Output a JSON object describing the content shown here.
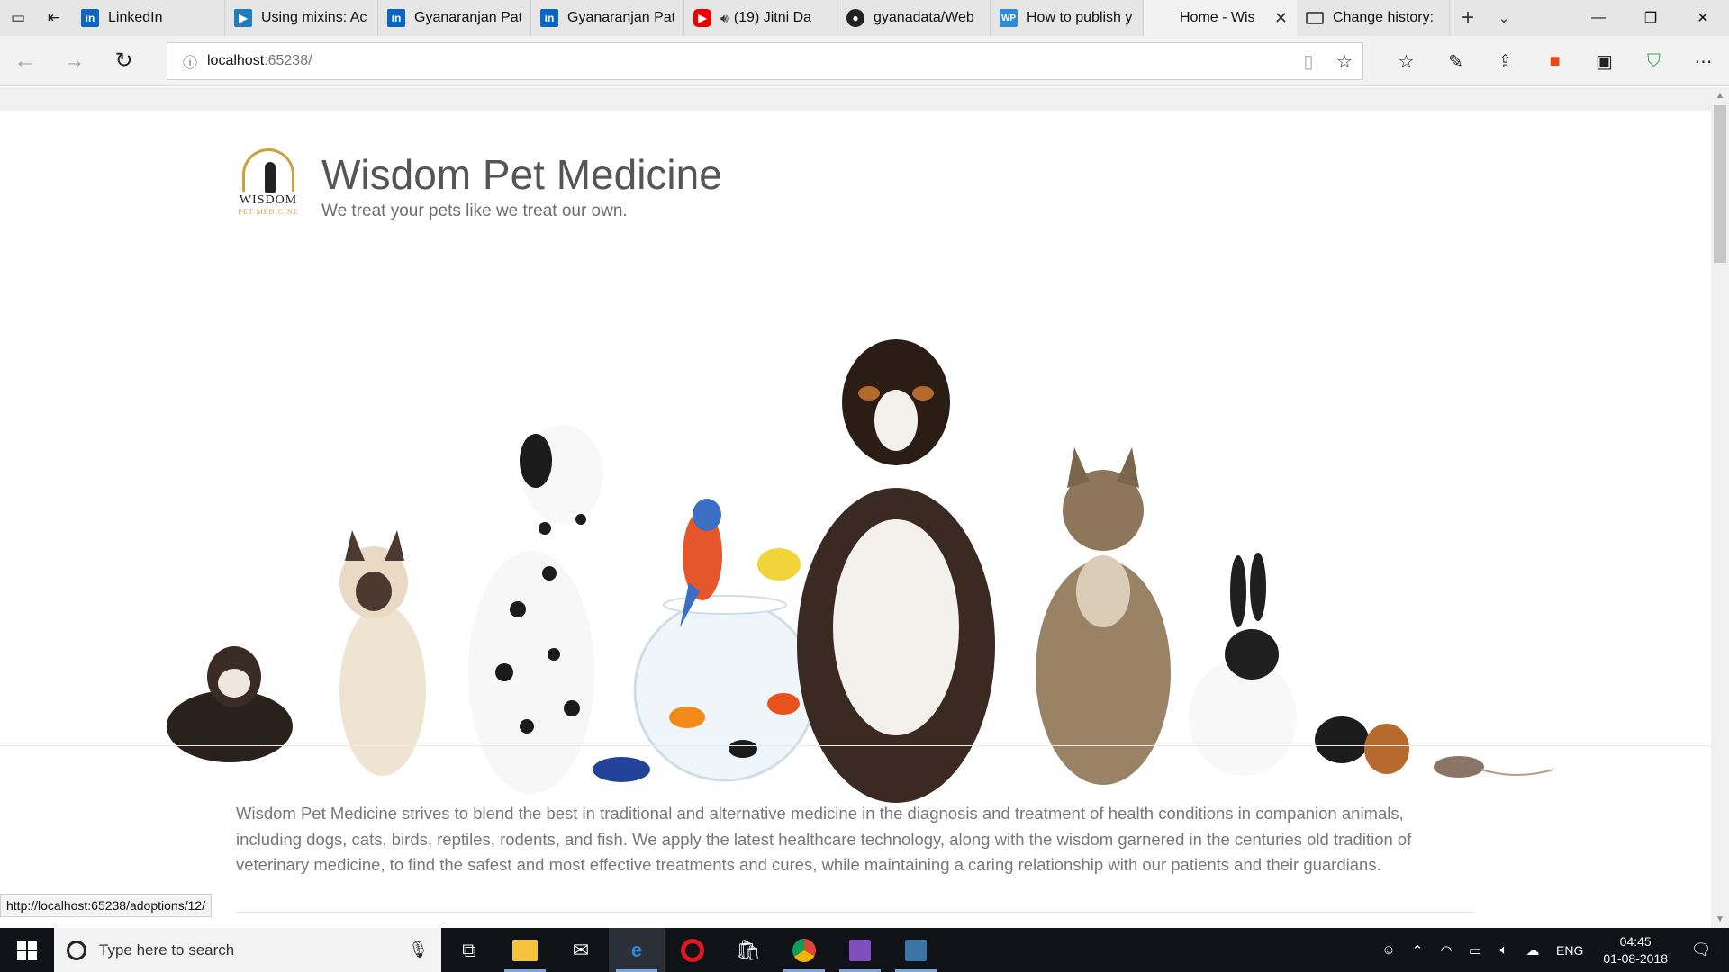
{
  "browser": {
    "tabs": [
      {
        "title": "LinkedIn",
        "favicon": "linkedin-icon"
      },
      {
        "title": "Using mixins: Ac",
        "favicon": "video-icon"
      },
      {
        "title": "Gyanaranjan Pat",
        "favicon": "linkedin-icon"
      },
      {
        "title": "Gyanaranjan Pat",
        "favicon": "linkedin-icon"
      },
      {
        "title": "(19) Jitni Da",
        "favicon": "youtube-icon",
        "playing_audio": true
      },
      {
        "title": "gyanadata/Web",
        "favicon": "github-icon"
      },
      {
        "title": "How to publish y",
        "favicon": "wordpress-icon"
      },
      {
        "title": "Home - Wis",
        "favicon": "",
        "active": true
      },
      {
        "title": "Change history:",
        "favicon": "page-icon"
      }
    ],
    "address": {
      "host": "localhost",
      "port": ":65238/"
    },
    "status_url": "http://localhost:65238/adoptions/12/"
  },
  "page": {
    "logo": {
      "line1": "WISDOM",
      "line2": "PET MEDICINE"
    },
    "title": "Wisdom Pet Medicine",
    "tagline": "We treat your pets like we treat our own.",
    "intro": "Wisdom Pet Medicine strives to blend the best in traditional and alternative medicine in the diagnosis and treatment of health conditions in companion animals, including dogs, cats, birds, reptiles, rodents, and fish. We apply the latest healthcare technology, along with the wisdom garnered in the centuries old tradition of veterinary medicine, to find the safest and most effective treatments and cures, while maintaining a caring relationship with our patients and their guardians."
  },
  "taskbar": {
    "search_placeholder": "Type here to search",
    "language": "ENG",
    "time": "04:45",
    "date": "01-08-2018"
  },
  "colors": {
    "logo_gold": "#c9a23c",
    "title_grey": "#555555",
    "taskbar_bg": "#101217"
  }
}
